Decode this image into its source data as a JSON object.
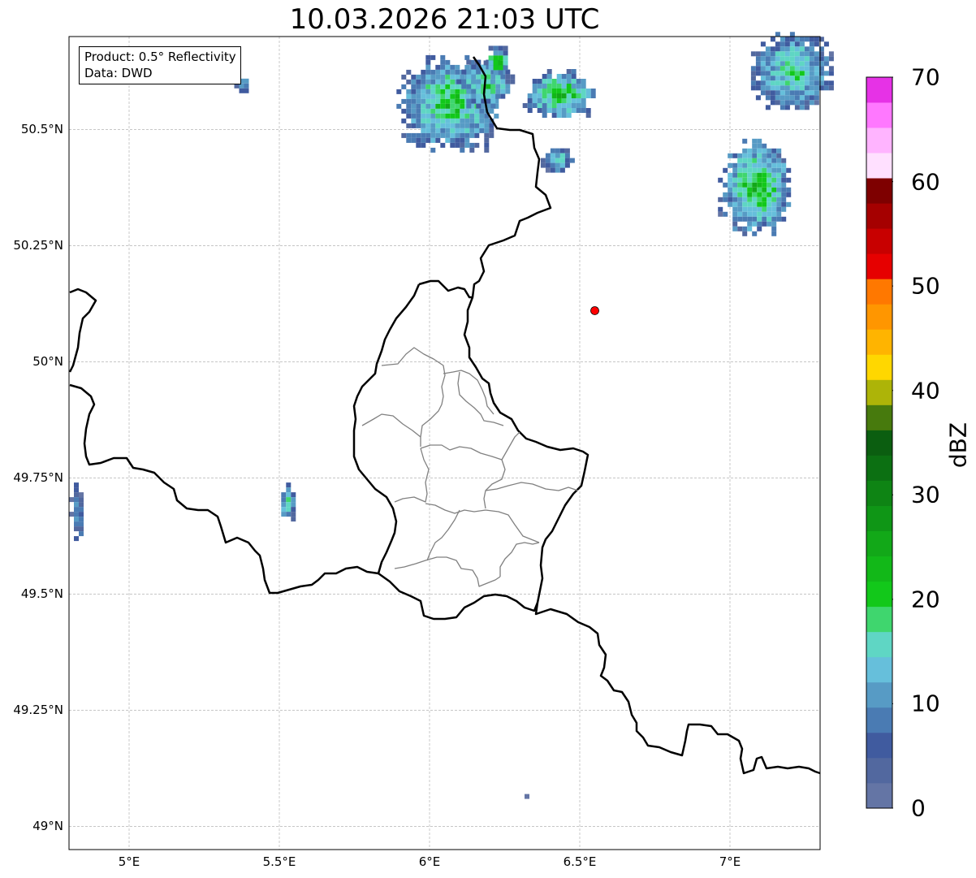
{
  "map": {
    "title": "10.03.2026 21:03 UTC",
    "info": {
      "product": "Product: 0.5° Reflectivity",
      "source": "Data: DWD"
    },
    "extent": {
      "lon_min": 4.8,
      "lon_max": 7.3,
      "lat_min": 48.95,
      "lat_max": 50.7
    },
    "lat_ticks": [
      {
        "label": "49°N",
        "value": 49.0
      },
      {
        "label": "49.25°N",
        "value": 49.25
      },
      {
        "label": "49.5°N",
        "value": 49.5
      },
      {
        "label": "49.75°N",
        "value": 49.75
      },
      {
        "label": "50°N",
        "value": 50.0
      },
      {
        "label": "50.25°N",
        "value": 50.25
      },
      {
        "label": "50.5°N",
        "value": 50.5
      }
    ],
    "lon_ticks": [
      {
        "label": "5°E",
        "value": 5.0
      },
      {
        "label": "5.5°E",
        "value": 5.5
      },
      {
        "label": "6°E",
        "value": 6.0
      },
      {
        "label": "6.5°E",
        "value": 6.5
      },
      {
        "label": "7°E",
        "value": 7.0
      }
    ],
    "marker": {
      "lon": 6.55,
      "lat": 50.11,
      "color": "#ff0000"
    },
    "echoes": [
      {
        "lon": 6.06,
        "lat": 50.56,
        "rlon": 0.17,
        "rlat": 0.1,
        "dbz": 22
      },
      {
        "lon": 6.18,
        "lat": 50.6,
        "rlon": 0.09,
        "rlat": 0.05,
        "dbz": 20
      },
      {
        "lon": 6.22,
        "lat": 50.65,
        "rlon": 0.04,
        "rlat": 0.03,
        "dbz": 26
      },
      {
        "lon": 6.43,
        "lat": 50.58,
        "rlon": 0.12,
        "rlat": 0.05,
        "dbz": 24
      },
      {
        "lon": 6.42,
        "lat": 50.44,
        "rlon": 0.05,
        "rlat": 0.03,
        "dbz": 16
      },
      {
        "lon": 7.08,
        "lat": 50.38,
        "rlon": 0.12,
        "rlat": 0.1,
        "dbz": 24
      },
      {
        "lon": 7.2,
        "lat": 50.63,
        "rlon": 0.13,
        "rlat": 0.08,
        "dbz": 20
      },
      {
        "lon": 5.52,
        "lat": 49.7,
        "rlon": 0.03,
        "rlat": 0.04,
        "dbz": 18
      },
      {
        "lon": 4.82,
        "lat": 49.68,
        "rlon": 0.02,
        "rlat": 0.06,
        "dbz": 12
      },
      {
        "lon": 6.32,
        "lat": 49.07,
        "rlon": 0.02,
        "rlat": 0.01,
        "dbz": 6
      },
      {
        "lon": 5.37,
        "lat": 50.6,
        "rlon": 0.02,
        "rlat": 0.02,
        "dbz": 14
      }
    ],
    "colorbar": {
      "label": "dBZ",
      "min": 0,
      "max": 70,
      "ticks": [
        "0",
        "10",
        "20",
        "30",
        "40",
        "50",
        "60",
        "70"
      ],
      "colors": [
        "#6475a5",
        "#52689f",
        "#405b9f",
        "#4a7bb3",
        "#579bc5",
        "#66bfdb",
        "#5fd6c4",
        "#3fd66e",
        "#12c81a",
        "#12b818",
        "#12a818",
        "#0f9616",
        "#0e8414",
        "#0c7012",
        "#0b5e10",
        "#477a0d",
        "#adb408",
        "#ffd700",
        "#ffb400",
        "#ff9600",
        "#ff7800",
        "#e60000",
        "#c80000",
        "#a50000",
        "#7e0000",
        "#ffe0ff",
        "#ffb4ff",
        "#ff78ff",
        "#e632e6"
      ]
    }
  }
}
